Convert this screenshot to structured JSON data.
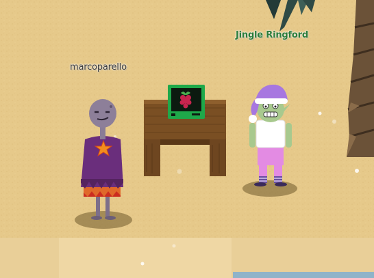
{
  "players": [
    {
      "name": "marcoparello",
      "name_color": "#3b3b3b"
    },
    {
      "name": "Jingle Ringford",
      "name_color": "#2c7d3a"
    }
  ],
  "colors": {
    "sand": "#e6c98a",
    "sand_path": "#eed6a1",
    "water": "#8fb3c9",
    "table_wood": "#7a4f23",
    "monitor_frame": "#1fa84a",
    "raspberry": "#c7254e",
    "elf_hat": "#a777e0",
    "elf_pants": "#e38be3"
  },
  "icons": [
    "raspberry-pi-icon",
    "palm-leaves-icon",
    "palm-trunk-icon"
  ]
}
